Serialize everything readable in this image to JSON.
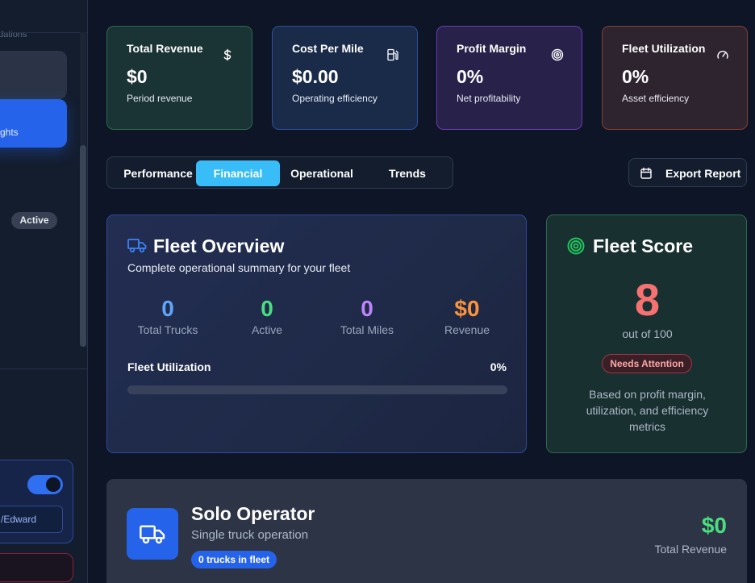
{
  "sidebar": {
    "recommendations_fragment": "dations",
    "selected_item_fragment": "ghts",
    "status_badge": "Active",
    "field_value_fragment": "/Edward"
  },
  "kpis": [
    {
      "title": "Total Revenue",
      "value": "$0",
      "sub": "Period revenue",
      "icon": "dollar-icon"
    },
    {
      "title": "Cost Per Mile",
      "value": "$0.00",
      "sub": "Operating efficiency",
      "icon": "fuel-pump-icon"
    },
    {
      "title": "Profit Margin",
      "value": "0%",
      "sub": "Net profitability",
      "icon": "target-icon"
    },
    {
      "title": "Fleet Utilization",
      "value": "0%",
      "sub": "Asset efficiency",
      "icon": "gauge-icon"
    }
  ],
  "tabs": [
    {
      "label": "Performance",
      "active": false
    },
    {
      "label": "Financial",
      "active": true
    },
    {
      "label": "Operational",
      "active": false
    },
    {
      "label": "Trends",
      "active": false
    }
  ],
  "export_label": "Export Report",
  "overview": {
    "title": "Fleet Overview",
    "subtitle": "Complete operational summary for your fleet",
    "stats": [
      {
        "value": "0",
        "label": "Total Trucks"
      },
      {
        "value": "0",
        "label": "Active"
      },
      {
        "value": "0",
        "label": "Total Miles"
      },
      {
        "value": "$0",
        "label": "Revenue"
      }
    ],
    "utilization_label": "Fleet Utilization",
    "utilization_value": "0%",
    "utilization_fraction": 0
  },
  "score": {
    "title": "Fleet Score",
    "value": "8",
    "out_of": "out of 100",
    "badge": "Needs Attention",
    "description": "Based on profit margin, utilization, and efficiency metrics"
  },
  "solo": {
    "title": "Solo Operator",
    "subtitle": "Single truck operation",
    "badge": "0 trucks in fleet",
    "revenue": "$0",
    "revenue_label": "Total Revenue"
  },
  "colors": {
    "accent_blue": "#2563eb",
    "tab_active": "#38bdf8",
    "green": "#4ade80",
    "red": "#f87171",
    "purple": "#c084fc",
    "orange": "#fb923c"
  }
}
